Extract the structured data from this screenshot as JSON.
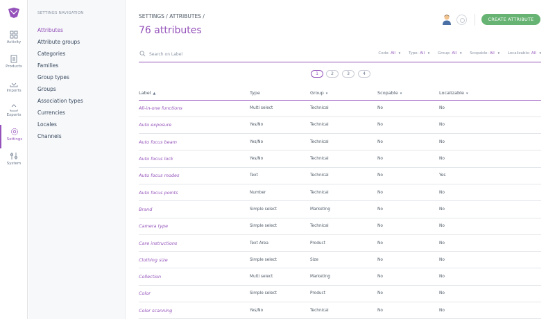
{
  "main_nav": [
    {
      "label": "Activity",
      "icon": "activity-icon"
    },
    {
      "label": "Products",
      "icon": "products-icon"
    },
    {
      "label": "Imports",
      "icon": "imports-icon"
    },
    {
      "label": "Exports",
      "icon": "exports-icon"
    },
    {
      "label": "Settings",
      "icon": "settings-icon",
      "active": true
    },
    {
      "label": "System",
      "icon": "system-icon"
    }
  ],
  "settings_nav": {
    "title": "SETTINGS NAVIGATION",
    "items": [
      "Attributes",
      "Attribute groups",
      "Categories",
      "Families",
      "Group types",
      "Groups",
      "Association types",
      "Currencies",
      "Locales",
      "Channels"
    ]
  },
  "header": {
    "breadcrumb": "SETTINGS / ATTRIBUTES /",
    "title": "76 attributes",
    "create_button": "CREATE ATTRIBUTE"
  },
  "search": {
    "placeholder": "Search on Label"
  },
  "filters": [
    {
      "name": "Code",
      "value": "All"
    },
    {
      "name": "Type",
      "value": "All"
    },
    {
      "name": "Group",
      "value": "All"
    },
    {
      "name": "Scopable",
      "value": "All"
    },
    {
      "name": "Localizable",
      "value": "All"
    }
  ],
  "pagination": [
    "1",
    "2",
    "3",
    "4"
  ],
  "columns": [
    "Label",
    "Type",
    "Group",
    "Scopable",
    "Localizable"
  ],
  "rows": [
    [
      "All-in-one functions",
      "Multi select",
      "Technical",
      "No",
      "No"
    ],
    [
      "Auto exposure",
      "Yes/No",
      "Technical",
      "No",
      "No"
    ],
    [
      "Auto focus beam",
      "Yes/No",
      "Technical",
      "No",
      "No"
    ],
    [
      "Auto focus lock",
      "Yes/No",
      "Technical",
      "No",
      "No"
    ],
    [
      "Auto focus modes",
      "Text",
      "Technical",
      "No",
      "Yes"
    ],
    [
      "Auto focus points",
      "Number",
      "Technical",
      "No",
      "No"
    ],
    [
      "Brand",
      "Simple select",
      "Marketing",
      "No",
      "No"
    ],
    [
      "Camera type",
      "Simple select",
      "Technical",
      "No",
      "No"
    ],
    [
      "Care instructions",
      "Text Area",
      "Product",
      "No",
      "No"
    ],
    [
      "Clothing size",
      "Simple select",
      "Size",
      "No",
      "No"
    ],
    [
      "Collection",
      "Multi select",
      "Marketing",
      "No",
      "No"
    ],
    [
      "Color",
      "Simple select",
      "Product",
      "No",
      "No"
    ],
    [
      "Color scanning",
      "Yes/No",
      "Technical",
      "No",
      "No"
    ]
  ],
  "colors": {
    "accent": "#9452ba",
    "create_button": "#67b373",
    "text": "#4d5966"
  }
}
